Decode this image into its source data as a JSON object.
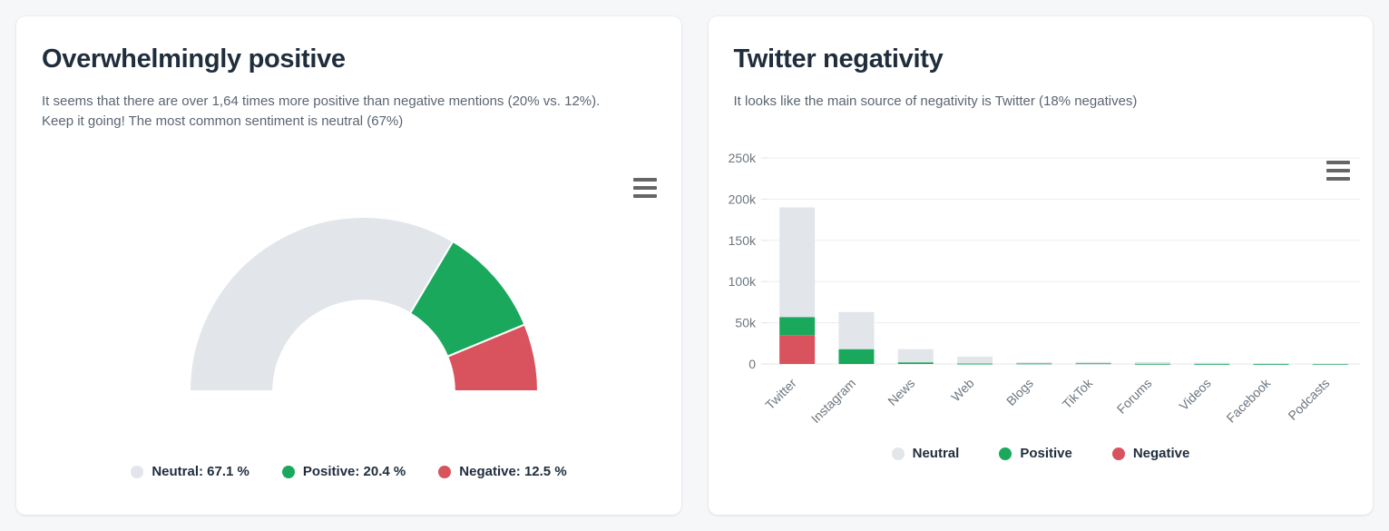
{
  "page": {
    "background": "#f6f7f9"
  },
  "colors": {
    "neutral": "#e2e5e9",
    "positive": "#1aa85c",
    "negative": "#d9535f",
    "title": "#1f2d3d",
    "description": "#5b6571",
    "gridline": "#ededf0",
    "axis_label": "#6b7680",
    "menu_icon": "#666666"
  },
  "left_card": {
    "title": "Overwhelmingly positive",
    "description": "It seems that there are over 1,64 times more positive than negative mentions (20% vs. 12%). Keep it going! The most common sentiment is neutral (67%)",
    "menu_button_label": "Chart context menu",
    "legend": [
      {
        "label": "Neutral: 67.1 %",
        "color": "#e2e5e9"
      },
      {
        "label": "Positive: 20.4 %",
        "color": "#1aa85c"
      },
      {
        "label": "Negative: 12.5 %",
        "color": "#d9535f"
      }
    ]
  },
  "right_card": {
    "title": "Twitter negativity",
    "description": "It looks like the main source of negativity is Twitter (18% negatives)",
    "menu_button_label": "Chart context menu",
    "legend": [
      {
        "label": "Neutral",
        "color": "#e2e5e9"
      },
      {
        "label": "Positive",
        "color": "#1aa85c"
      },
      {
        "label": "Negative",
        "color": "#d9535f"
      }
    ]
  },
  "chart_data": [
    {
      "type": "pie",
      "id": "sentiment-gauge",
      "title": "Overwhelmingly positive",
      "subtitle": "It seems that there are over 1,64 times more positive than negative mentions (20% vs. 12%). Keep it going! The most common sentiment is neutral (67%)",
      "variant": "semicircle-donut",
      "start_angle": -90,
      "end_angle": 90,
      "inner_radius_pct": 52,
      "labels": [
        "Neutral",
        "Positive",
        "Negative"
      ],
      "values": [
        67.1,
        20.4,
        12.5
      ],
      "unit": "%",
      "colors": [
        "#e2e5e9",
        "#1aa85c",
        "#d9535f"
      ],
      "legend_position": "bottom",
      "legend_entries": [
        "Neutral: 67.1 %",
        "Positive: 20.4 %",
        "Negative: 12.5 %"
      ],
      "grid": false
    },
    {
      "type": "bar",
      "id": "source-sentiment-bars",
      "variant": "stacked",
      "title": "Twitter negativity",
      "subtitle": "It looks like the main source of negativity is Twitter (18% negatives)",
      "xlabel": "",
      "ylabel": "",
      "categories": [
        "Twitter",
        "Instagram",
        "News",
        "Web",
        "Blogs",
        "TikTok",
        "Forums",
        "Videos",
        "Facebook",
        "Podcasts"
      ],
      "ylim": [
        0,
        250000
      ],
      "yticks": [
        0,
        50000,
        100000,
        150000,
        200000,
        250000
      ],
      "ytick_labels": [
        "0",
        "50k",
        "100k",
        "150k",
        "200k",
        "250k"
      ],
      "series": [
        {
          "name": "Negative",
          "color": "#d9535f",
          "values": [
            35000,
            0,
            0,
            0,
            0,
            0,
            0,
            0,
            0,
            0
          ]
        },
        {
          "name": "Positive",
          "color": "#1aa85c",
          "values": [
            22000,
            18000,
            2000,
            500,
            700,
            900,
            300,
            200,
            100,
            100
          ]
        },
        {
          "name": "Neutral",
          "color": "#e2e5e9",
          "values": [
            133000,
            45000,
            16000,
            8500,
            1500,
            1600,
            2200,
            1400,
            900,
            700
          ]
        }
      ],
      "totals": [
        190000,
        63000,
        18000,
        9000,
        2200,
        2500,
        2500,
        1600,
        1000,
        800
      ],
      "grid": true,
      "gridline_color": "#ededf0",
      "legend_position": "bottom",
      "legend_entries": [
        "Neutral",
        "Positive",
        "Negative"
      ],
      "xtick_rotation": -45
    }
  ]
}
